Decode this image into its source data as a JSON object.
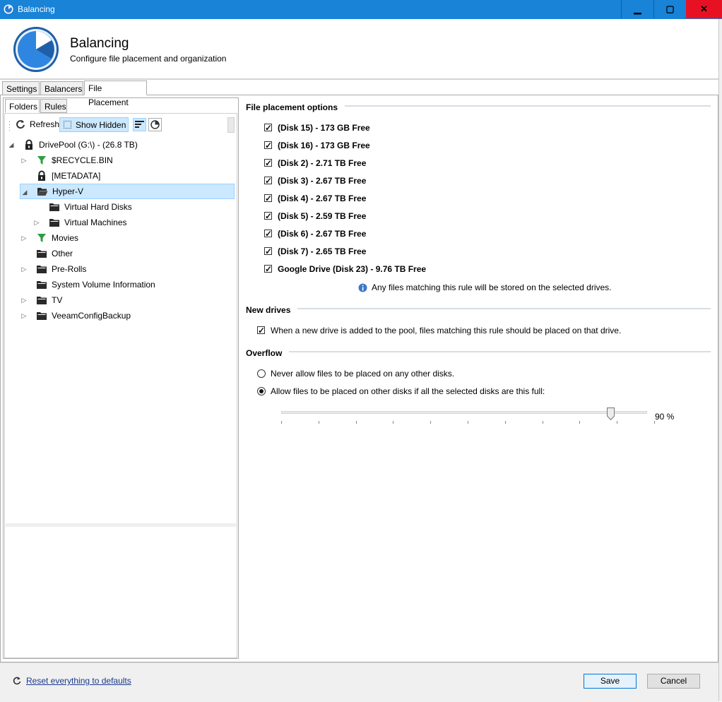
{
  "window": {
    "title": "Balancing",
    "minimize_icon": "minimize-icon",
    "maximize_icon": "maximize-icon",
    "close_icon": "close-icon",
    "min_glyph": "▁",
    "max_glyph": "▢",
    "close_glyph": "✕",
    "titlebar_color": "#1883d7",
    "close_color": "#e81123"
  },
  "header": {
    "title": "Balancing",
    "subtitle": "Configure file placement and organization"
  },
  "tabs": [
    {
      "label": "Settings",
      "active": false
    },
    {
      "label": "Balancers",
      "active": false
    },
    {
      "label": "File Placement",
      "active": true
    }
  ],
  "left": {
    "subtabs": [
      {
        "label": "Folders",
        "active": true
      },
      {
        "label": "Rules",
        "active": false
      }
    ],
    "toolbar": {
      "refresh_label": "Refresh",
      "show_hidden_label": "Show Hidden"
    },
    "tree": [
      {
        "label": "DrivePool (G:\\) - (26.8 TB)",
        "icon": "lock-icon",
        "expander": "expanded"
      },
      {
        "label": "$RECYCLE.BIN",
        "icon": "filter-icon",
        "expander": "collapsed"
      },
      {
        "label": "[METADATA]",
        "icon": "lock-icon",
        "expander": "none"
      },
      {
        "label": "Hyper-V",
        "icon": "folder-open-icon",
        "expander": "expanded",
        "selected": true
      },
      {
        "label": "Virtual Hard Disks",
        "icon": "folder-icon",
        "expander": "none"
      },
      {
        "label": "Virtual Machines",
        "icon": "folder-icon",
        "expander": "collapsed"
      },
      {
        "label": "Movies",
        "icon": "filter-icon",
        "expander": "collapsed"
      },
      {
        "label": "Other",
        "icon": "folder-icon",
        "expander": "none"
      },
      {
        "label": "Pre-Rolls",
        "icon": "folder-icon",
        "expander": "collapsed"
      },
      {
        "label": "System Volume Information",
        "icon": "folder-icon",
        "expander": "none"
      },
      {
        "label": "TV",
        "icon": "folder-icon",
        "expander": "collapsed"
      },
      {
        "label": "VeeamConfigBackup",
        "icon": "folder-icon",
        "expander": "collapsed"
      }
    ]
  },
  "placement": {
    "heading": "File placement options",
    "disks": [
      {
        "label": "(Disk 15) - 173 GB Free",
        "checked": true
      },
      {
        "label": "(Disk 16) - 173 GB Free",
        "checked": true
      },
      {
        "label": "(Disk 2) - 2.71 TB Free",
        "checked": true
      },
      {
        "label": "(Disk 3) - 2.67 TB Free",
        "checked": true
      },
      {
        "label": "(Disk 4) - 2.67 TB Free",
        "checked": true
      },
      {
        "label": "(Disk 5) - 2.59 TB Free",
        "checked": true
      },
      {
        "label": "(Disk 6) - 2.67 TB Free",
        "checked": true
      },
      {
        "label": "(Disk 7) - 2.65 TB Free",
        "checked": true
      },
      {
        "label": "Google Drive (Disk 23) - 9.76 TB Free",
        "checked": true
      }
    ],
    "info_text": "Any files matching this rule will be stored on the selected drives."
  },
  "new_drives": {
    "heading": "New drives",
    "option_label": "When a new drive is added to the pool, files matching this rule should be placed on that drive.",
    "checked": true
  },
  "overflow": {
    "heading": "Overflow",
    "options": [
      {
        "label": "Never allow files to be placed on any other disks.",
        "selected": false
      },
      {
        "label": "Allow files to be placed on other disks if all the selected disks are this full:",
        "selected": true
      }
    ],
    "slider_value": 90,
    "slider_label": "90 %"
  },
  "footer": {
    "reset_label": "Reset everything to defaults",
    "save_label": "Save",
    "cancel_label": "Cancel"
  }
}
